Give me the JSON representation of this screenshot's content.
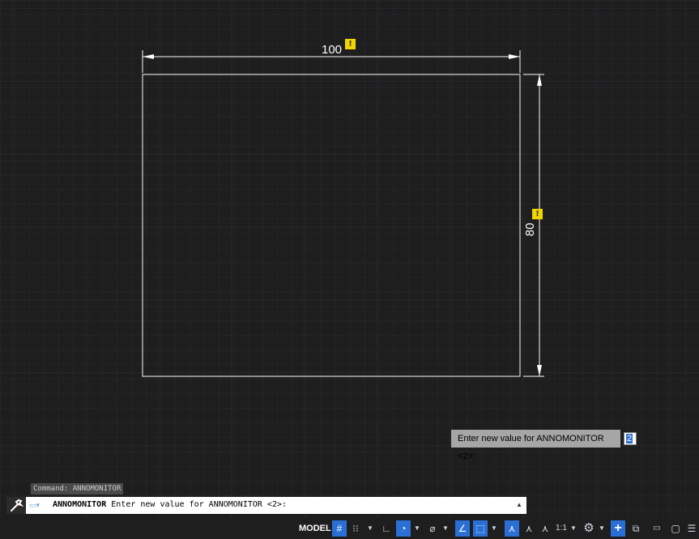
{
  "drawing": {
    "dim_horizontal_value": "100",
    "dim_vertical_value": "80",
    "warning_badge": "!",
    "colors": {
      "background": "#1e1e1e",
      "grid_minor": "#262a2e",
      "grid_major": "#2b323a",
      "geometry": "#ffffff",
      "warning": "#f1d400"
    }
  },
  "tooltip": {
    "prompt": "Enter new value for ANNOMONITOR <2>:",
    "value": "2"
  },
  "command": {
    "history": "Command: ANNOMONITOR",
    "current_command": "ANNOMONITOR",
    "current_prompt": "Enter new value for ANNOMONITOR <2>:"
  },
  "statusbar": {
    "model_label": "MODEL",
    "scale_label": "1:1",
    "items": [
      {
        "icon": "grid-icon",
        "active": true
      },
      {
        "icon": "snap-icon",
        "active": false
      },
      {
        "icon": "ortho-icon",
        "active": false
      },
      {
        "icon": "polar-icon",
        "active": true
      },
      {
        "icon": "isodraft-icon",
        "active": false
      },
      {
        "icon": "object-snap-tracking-icon",
        "active": true
      },
      {
        "icon": "object-snap-icon",
        "active": true
      },
      {
        "icon": "annotation-visibility-icon",
        "active": true
      },
      {
        "icon": "auto-scale-icon",
        "active": false
      },
      {
        "icon": "annotation-scale-icon",
        "active": false
      },
      {
        "icon": "workspace-gear-icon",
        "active": false
      },
      {
        "icon": "annotation-monitor-icon",
        "active": true
      },
      {
        "icon": "isolate-objects-icon",
        "active": false
      },
      {
        "icon": "hardware-acceleration-icon",
        "active": false
      },
      {
        "icon": "clean-screen-icon",
        "active": false
      },
      {
        "icon": "customization-menu-icon",
        "active": false
      }
    ]
  }
}
